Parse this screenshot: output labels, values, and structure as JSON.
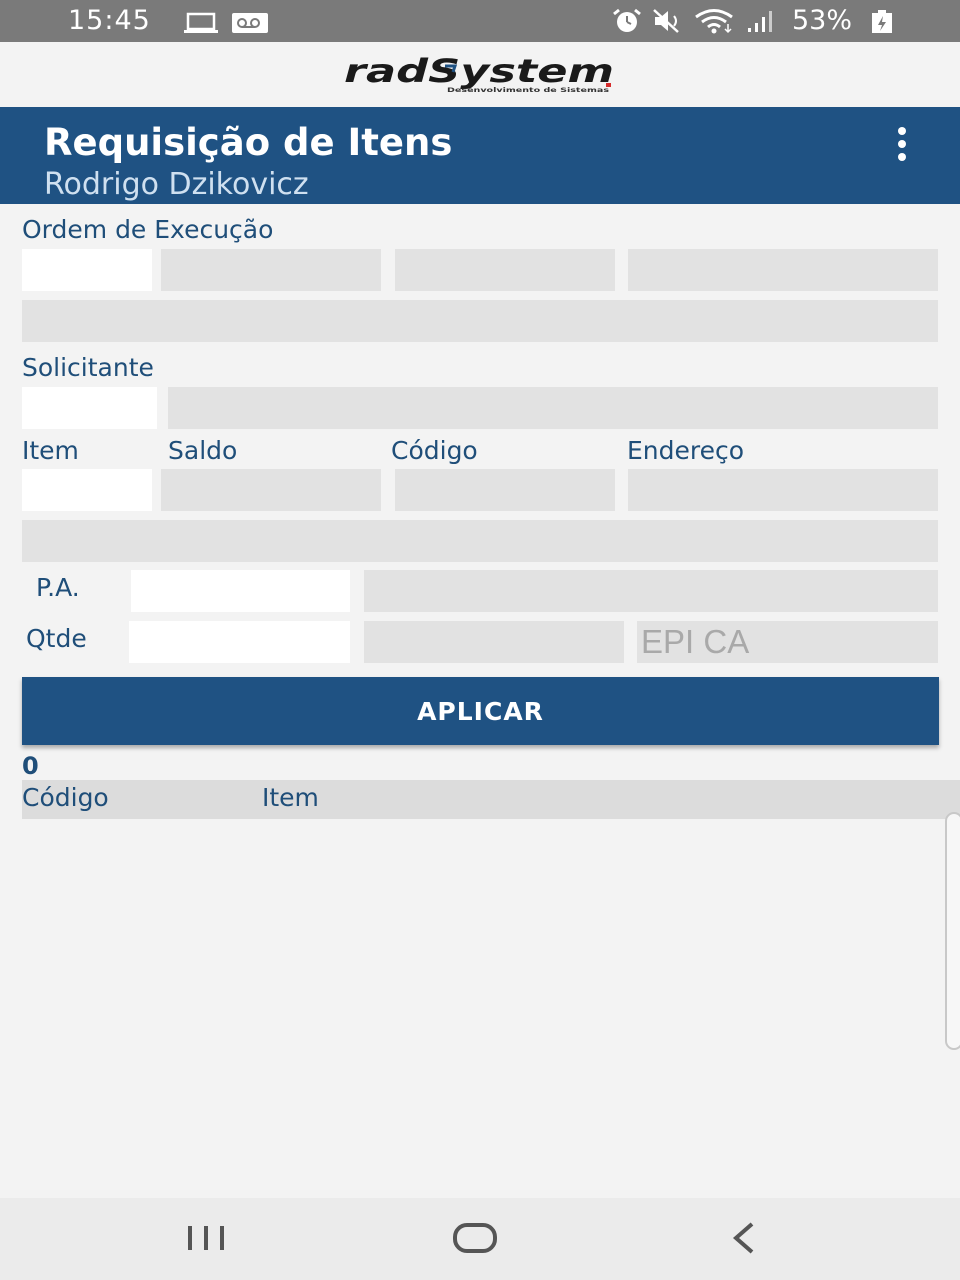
{
  "status_bar": {
    "time": "15:45",
    "battery": "53%",
    "icons": [
      "laptop-icon",
      "voicemail-icon",
      "alarm-icon",
      "mute-icon",
      "wifi-icon",
      "signal-icon",
      "battery-icon"
    ]
  },
  "logo": {
    "name": "radSystem",
    "tagline": "Desenvolvimento de Sistemas"
  },
  "appbar": {
    "title": "Requisição de Itens",
    "subtitle": "Rodrigo Dzikovicz",
    "menu_icon": "more-vert-icon"
  },
  "form": {
    "ordem_label": "Ordem de Execução",
    "solicitante_label": "Solicitante",
    "item_label": "Item",
    "saldo_label": "Saldo",
    "codigo_label": "Código",
    "endereco_label": "Endereço",
    "pa_label": "P.A.",
    "qtde_label": "Qtde",
    "epi_placeholder": "EPI CA"
  },
  "apply_button": "APLICAR",
  "results": {
    "count": "0",
    "columns": [
      "Código",
      "Item"
    ]
  },
  "nav_bar": {
    "icons": [
      "recent-apps-icon",
      "home-icon",
      "back-icon"
    ]
  },
  "colors": {
    "primary": "#1f5283",
    "field_gray": "#e2e2e2",
    "background": "#f3f3f3"
  }
}
